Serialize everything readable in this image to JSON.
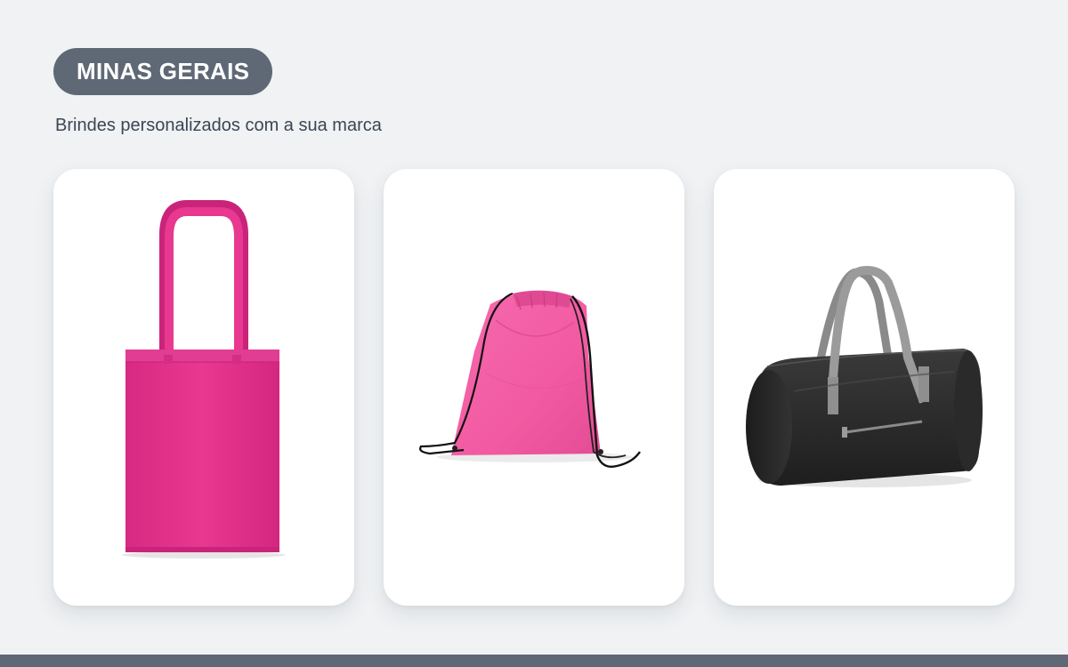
{
  "header": {
    "badge_label": "MINAS GERAIS",
    "subtitle": "Brindes personalizados com a sua marca"
  },
  "products": [
    {
      "icon": "tote-bag-icon",
      "color": "#e8388f"
    },
    {
      "icon": "drawstring-backpack-icon",
      "color": "#f25aa2"
    },
    {
      "icon": "duffel-bag-icon",
      "color": "#2d2d2d"
    }
  ],
  "colors": {
    "background": "#f0f2f4",
    "badge": "#5f6875",
    "subtitle_text": "#3b4654",
    "footer_bar": "#5f6875"
  }
}
